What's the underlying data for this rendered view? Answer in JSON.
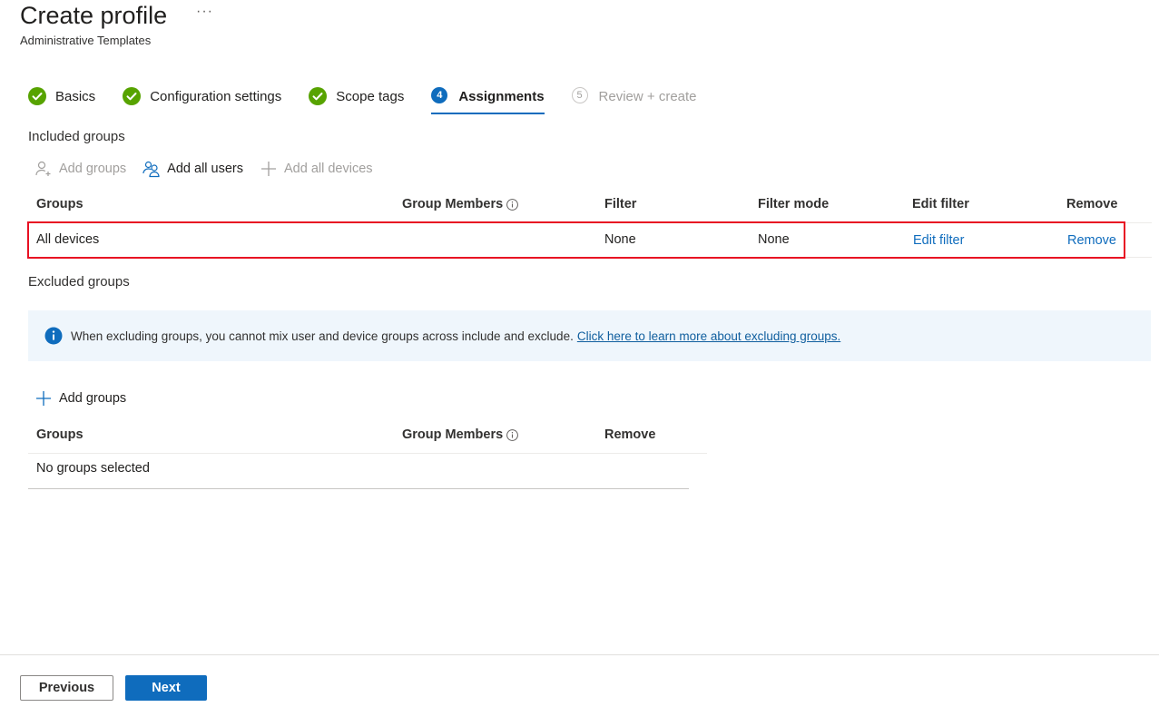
{
  "header": {
    "title": "Create profile",
    "more": "···",
    "subtitle": "Administrative Templates"
  },
  "steps": [
    {
      "label": "Basics",
      "state": "complete"
    },
    {
      "label": "Configuration settings",
      "state": "complete"
    },
    {
      "label": "Scope tags",
      "state": "complete"
    },
    {
      "label": "Assignments",
      "state": "active",
      "number": "4"
    },
    {
      "label": "Review + create",
      "state": "disabled",
      "number": "5"
    }
  ],
  "included": {
    "title": "Included groups",
    "toolbar": {
      "add_groups": "Add groups",
      "add_all_users": "Add all users",
      "add_all_devices": "Add all devices"
    },
    "columns": {
      "groups": "Groups",
      "group_members": "Group Members",
      "filter": "Filter",
      "filter_mode": "Filter mode",
      "edit_filter": "Edit filter",
      "remove": "Remove"
    },
    "rows": [
      {
        "group": "All devices",
        "filter": "None",
        "filter_mode": "None",
        "edit_filter": "Edit filter",
        "remove": "Remove"
      }
    ]
  },
  "excluded": {
    "title": "Excluded groups",
    "info_text": "When excluding groups, you cannot mix user and device groups across include and exclude.",
    "info_link": "Click here to learn more about excluding groups.",
    "add_groups": "Add groups",
    "columns": {
      "groups": "Groups",
      "group_members": "Group Members",
      "remove": "Remove"
    },
    "empty_text": "No groups selected"
  },
  "footer": {
    "previous": "Previous",
    "next": "Next"
  },
  "colors": {
    "accent": "#0f6cbd",
    "success": "#57a300",
    "highlight": "#e81123",
    "info_bg": "#eff6fc"
  }
}
